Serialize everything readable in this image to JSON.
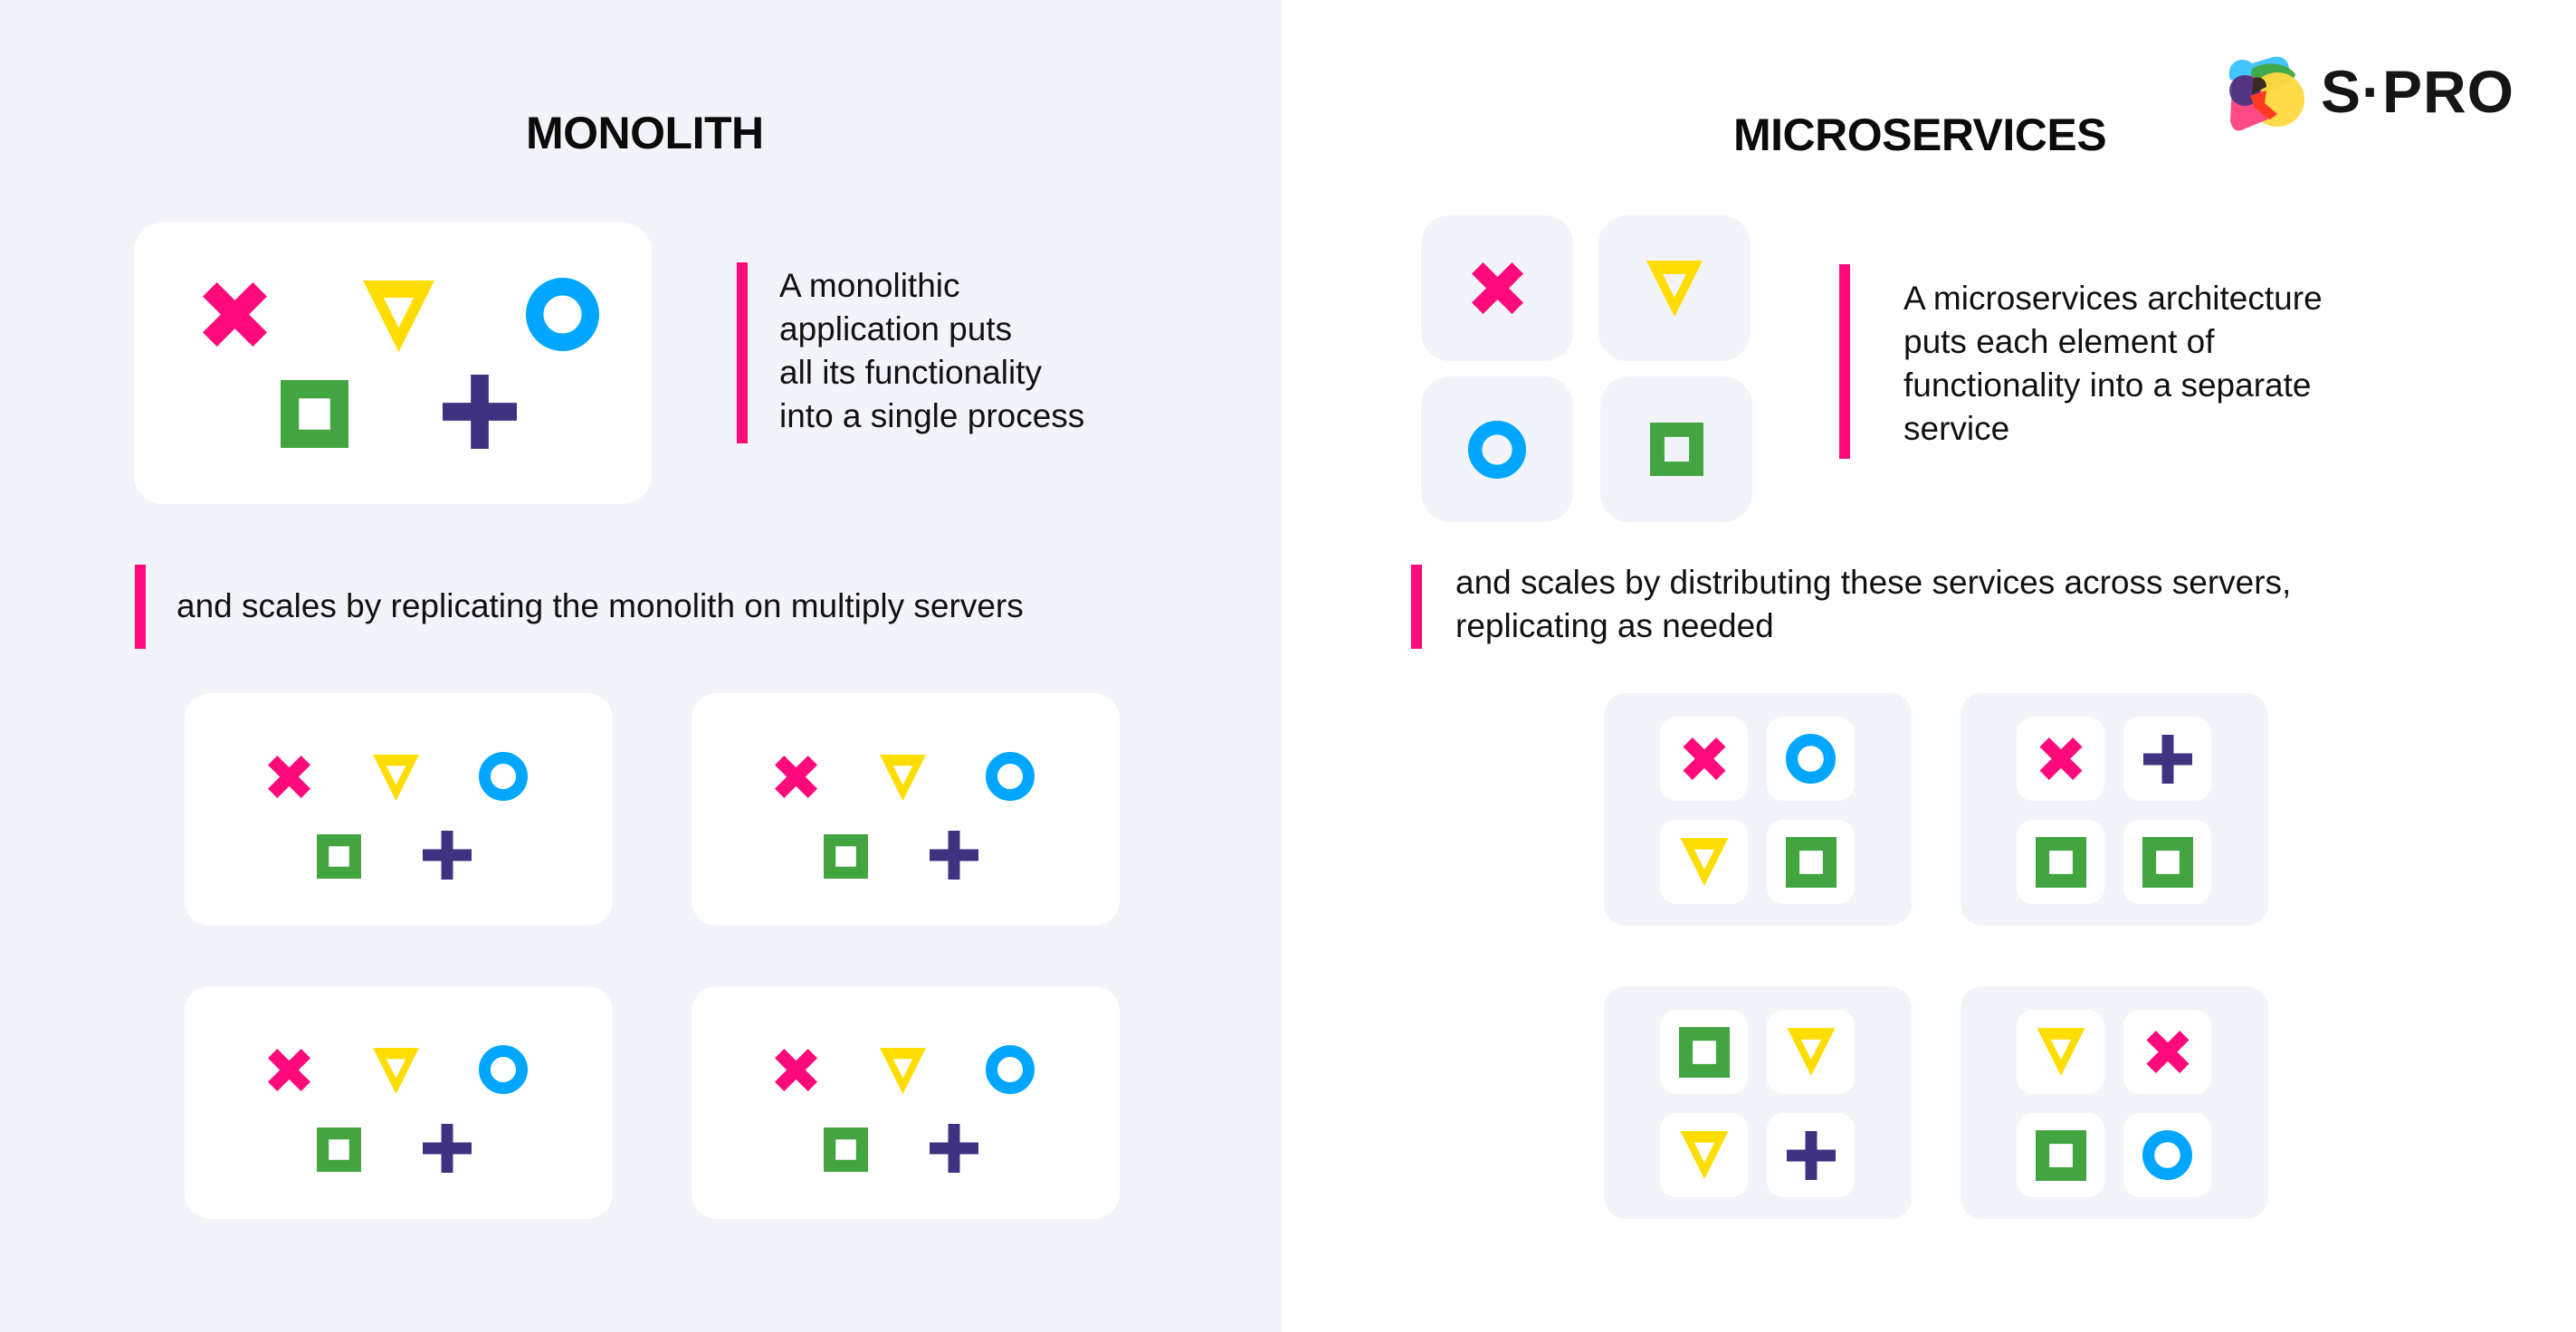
{
  "brand": {
    "name": "S·PRO",
    "logo_icon": "heart-speech-bubble-logo-icon"
  },
  "colors": {
    "left_background": "#f3f4f9",
    "right_background": "#ffffff",
    "accent": "#ff0a7a",
    "cross": "#ff0a7a",
    "triangle": "#ffdd00",
    "circle": "#00a6ff",
    "square": "#43a542",
    "plus": "#3f3381"
  },
  "monolith": {
    "title": "MONOLITH",
    "description": "A monolithic\napplication puts\nall its functionality\ninto a single process",
    "scaling_text": "and scales by replicating the monolith on multiply servers",
    "application_shapes": [
      "cross",
      "triangle",
      "circle",
      "square",
      "plus"
    ],
    "servers": [
      {
        "shapes": [
          "cross",
          "triangle",
          "circle",
          "square",
          "plus"
        ]
      },
      {
        "shapes": [
          "cross",
          "triangle",
          "circle",
          "square",
          "plus"
        ]
      },
      {
        "shapes": [
          "cross",
          "triangle",
          "circle",
          "square",
          "plus"
        ]
      },
      {
        "shapes": [
          "cross",
          "triangle",
          "circle",
          "square",
          "plus"
        ]
      }
    ]
  },
  "microservices": {
    "title": "MICROSERVICES",
    "description": "A microservices architecture\nputs each element of\nfunctionality into a separate\nservice",
    "scaling_text": "and scales by distributing these services across servers,\nreplicating as needed",
    "services": [
      "cross",
      "triangle",
      "circle",
      "square"
    ],
    "servers": [
      {
        "services": [
          "cross",
          "circle",
          "triangle",
          "square"
        ]
      },
      {
        "services": [
          "cross",
          "plus",
          "square",
          "square"
        ]
      },
      {
        "services": [
          "square",
          "triangle",
          "triangle",
          "plus"
        ]
      },
      {
        "services": [
          "triangle",
          "cross",
          "square",
          "circle"
        ]
      }
    ]
  }
}
